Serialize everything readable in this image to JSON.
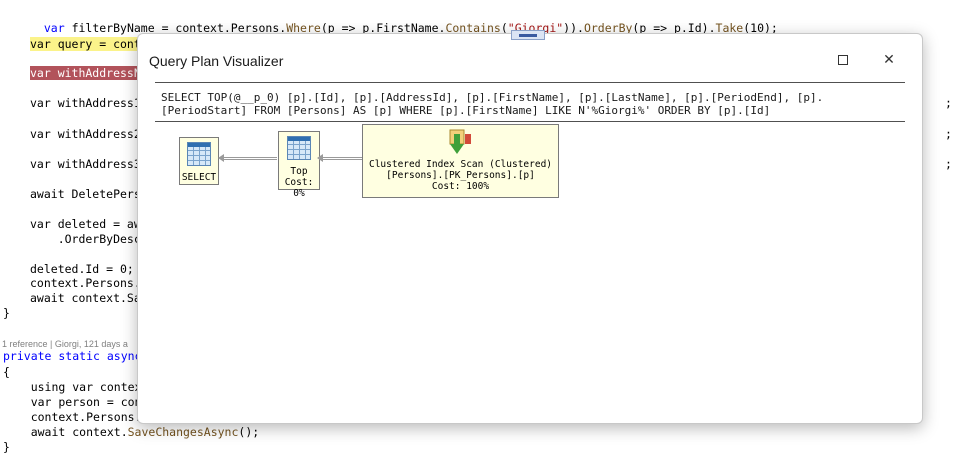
{
  "editor": {
    "line_filter": {
      "p1": "var ",
      "p2": "filterByName = context.Persons.",
      "p3": "Where",
      "p4": "(p => p.FirstName.",
      "p5": "Contains",
      "p6": "(",
      "p7": "\"Giorgi\"",
      "p8": ")).",
      "p9": "OrderBy",
      "p10": "(p => p.Id).",
      "p11": "Take",
      "p12": "(10);"
    },
    "line_query": "var query = cont",
    "line_withAddressN": "var withAddressN",
    "line_withAddress1": "var withAddress1",
    "line_withAddress2": "var withAddress2",
    "line_withAddress3": "var withAddress3",
    "line_await_delete": "await DeletePers",
    "line_deleted": "var deleted = aw",
    "line_orderbydesc": "    .OrderByDesc",
    "line_deleted_id": "deleted.Id = 0;",
    "line_context_persons1": "context.Persons.",
    "line_await_save1": "await context.Sa",
    "brace_close1": "}",
    "ref_lens": "1 reference | Giorgi, 121 days a",
    "line_private": "private static async",
    "brace_open": "{",
    "line_using": "    using var contex",
    "line_person": "    var person = con",
    "line_context_persons2": "    context.Persons.",
    "line_await_save2_a": "    await context.",
    "line_await_save2_b": "SaveChangesAsync",
    "line_await_save2_c": "();",
    "brace_close2": "}",
    "trailing_semis": [
      ";",
      ";",
      ";"
    ]
  },
  "dialog": {
    "title": "Query Plan Visualizer",
    "maximize_icon": "maximize-icon",
    "close_icon": "close-icon",
    "close_glyph": "✕",
    "sql_line1": "SELECT TOP(@__p_0) [p].[Id], [p].[AddressId], [p].[FirstName], [p].[LastName], [p].[PeriodEnd], [p].",
    "sql_line2": "[PeriodStart] FROM [Persons] AS [p] WHERE [p].[FirstName] LIKE N'%Giorgi%' ORDER BY [p].[Id]",
    "plan": {
      "select_node": {
        "label": "SELECT",
        "icon": "result-table-icon"
      },
      "top_node": {
        "label": "Top",
        "cost": "Cost: 0%",
        "icon": "top-table-icon"
      },
      "scan_node": {
        "label": "Clustered Index Scan (Clustered)",
        "object": "[Persons].[PK_Persons].[p]",
        "cost": "Cost: 100%",
        "icon": "clustered-index-scan-icon"
      }
    }
  },
  "colors": {
    "keyword": "#0000ff",
    "string": "#a31515",
    "method": "#74531f",
    "node_fill": "#ffffe1",
    "highlight_yellow": "#fbf38a",
    "highlight_red": "#b2535b"
  }
}
